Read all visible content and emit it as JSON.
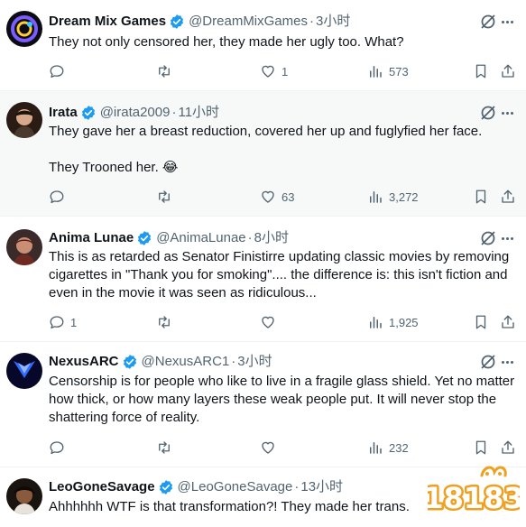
{
  "tweets": [
    {
      "name": "Dream Mix Games",
      "handle": "@DreamMixGames",
      "time": "3小时",
      "paragraphs": [
        "They not only censored her, they made her ugly too. What?"
      ],
      "replies": "",
      "retweets": "",
      "likes": "1",
      "views": "573"
    },
    {
      "name": "Irata",
      "handle": "@irata2009",
      "time": "11小时",
      "paragraphs": [
        "They gave her a breast reduction, covered her up and fuglyfied her face.",
        "They Trooned her. 😂"
      ],
      "replies": "",
      "retweets": "",
      "likes": "63",
      "views": "3,272"
    },
    {
      "name": "Anima Lunae",
      "handle": "@AnimaLunae",
      "time": "8小时",
      "paragraphs": [
        "This is as retarded as Senator Finistirre updating classic movies by removing cigarettes in \"Thank you for smoking\".... the difference is: this isn't fiction and even in the movie it was seen as ridiculous..."
      ],
      "replies": "1",
      "retweets": "",
      "likes": "",
      "views": "1,925"
    },
    {
      "name": "NexusARC",
      "handle": "@NexusARC1",
      "time": "3小时",
      "paragraphs": [
        "Censorship is for people who like to live in a fragile glass shield. Yet no matter how thick, or how many layers these weak people put. It will never stop the shattering force of reality."
      ],
      "replies": "",
      "retweets": "",
      "likes": "",
      "views": "232"
    },
    {
      "name": "LeoGoneSavage",
      "handle": "@LeoGoneSavage",
      "time": "13小时",
      "paragraphs": [
        "Ahhhhhh WTF is that transformation?! They made her trans."
      ]
    }
  ],
  "watermark": {
    "text": "18183",
    "color": "#f0a020"
  },
  "colors": {
    "verified": "#1d9bf0",
    "text": "#0f1419",
    "muted": "#536471",
    "highlight_bg": "#f7f9f9"
  },
  "icons": [
    "reply-icon",
    "retweet-icon",
    "like-icon",
    "views-icon",
    "bookmark-icon",
    "share-icon",
    "grok-icon",
    "more-icon",
    "verified-badge-icon"
  ]
}
